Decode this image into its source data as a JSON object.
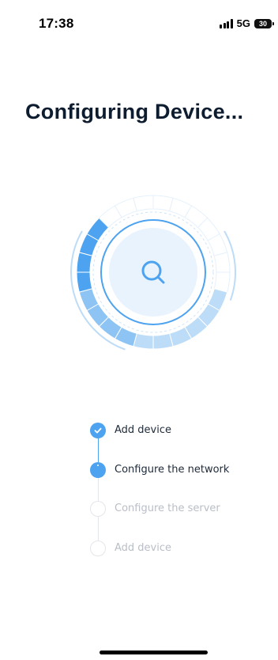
{
  "status_bar": {
    "time": "17:38",
    "network": "5G",
    "battery": "30",
    "signal_icon": "signal-bars-icon",
    "battery_icon": "battery-icon"
  },
  "header": {
    "title": "Configuring Device..."
  },
  "dial": {
    "center_icon": "search-icon",
    "progress": 0.3,
    "colors": {
      "accent": "#4da3ef",
      "light": "#bcdcf8",
      "track": "#e6f1fc"
    }
  },
  "steps": [
    {
      "label": "Add device",
      "status": "done"
    },
    {
      "label": "Configure the network",
      "status": "active"
    },
    {
      "label": "Configure the server",
      "status": "pending"
    },
    {
      "label": "Add device",
      "status": "pending"
    }
  ]
}
